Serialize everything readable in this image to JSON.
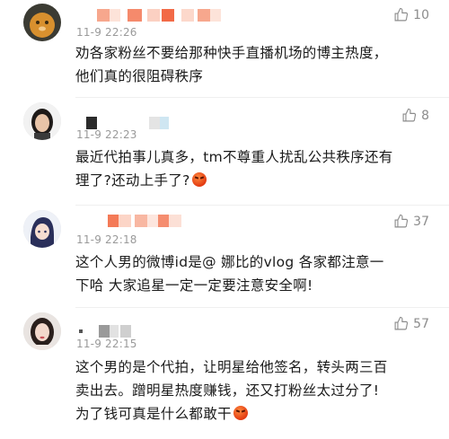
{
  "comments": [
    {
      "time": "11-9 22:26",
      "likes": "10",
      "line1": "劝各家粉丝不要给那种快手直播机场的博主热度，",
      "line2": "他们真的很阻碍秩序"
    },
    {
      "time": "11-9 22:23",
      "likes": "8",
      "line1": "最近代拍事儿真多，tm不尊重人扰乱公共秩序还有",
      "line2": "理了?还动上手了?"
    },
    {
      "time": "11-9 22:18",
      "likes": "37",
      "line1": "这个人男的微博id是@ 娜比的vlog 各家都注意一",
      "line2": "下哈 大家追星一定一定要注意安全啊!"
    },
    {
      "time": "11-9 22:15",
      "likes": "57",
      "line1": "这个男的是个代拍，让明星给他签名，转头两三百",
      "line2": "卖出去。蹭明星热度赚钱，还又打粉丝太过分了!",
      "line3": "为了钱可真是什么都敢干"
    }
  ]
}
